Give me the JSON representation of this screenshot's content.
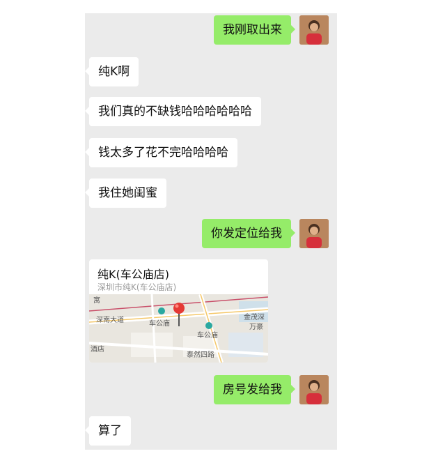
{
  "messages": [
    {
      "side": "out",
      "text": "我刚取出来"
    },
    {
      "side": "in",
      "text": "纯K啊"
    },
    {
      "side": "in",
      "text": "我们真的不缺钱哈哈哈哈哈哈"
    },
    {
      "side": "in",
      "text": "钱太多了花不完哈哈哈哈"
    },
    {
      "side": "in",
      "text": "我住她闺蜜"
    },
    {
      "side": "out",
      "text": "你发定位给我"
    },
    {
      "side": "out",
      "text": "房号发给我"
    },
    {
      "side": "in",
      "text": "算了"
    }
  ],
  "location": {
    "title": "纯K(车公庙店)",
    "address": "深圳市纯K(车公庙店)",
    "map_labels": {
      "shennan_road": "深南大道",
      "station1": "车公庙",
      "station2": "车公庙",
      "jinmao": "金茂深",
      "wanhao": "万豪",
      "taoranroad": "泰然四路",
      "hotel": "酒店",
      "corner": "寓"
    }
  },
  "colors": {
    "chat_bg": "#ebebeb",
    "bubble_out": "#95ec69",
    "bubble_in": "#ffffff",
    "pin": "#e53935"
  }
}
